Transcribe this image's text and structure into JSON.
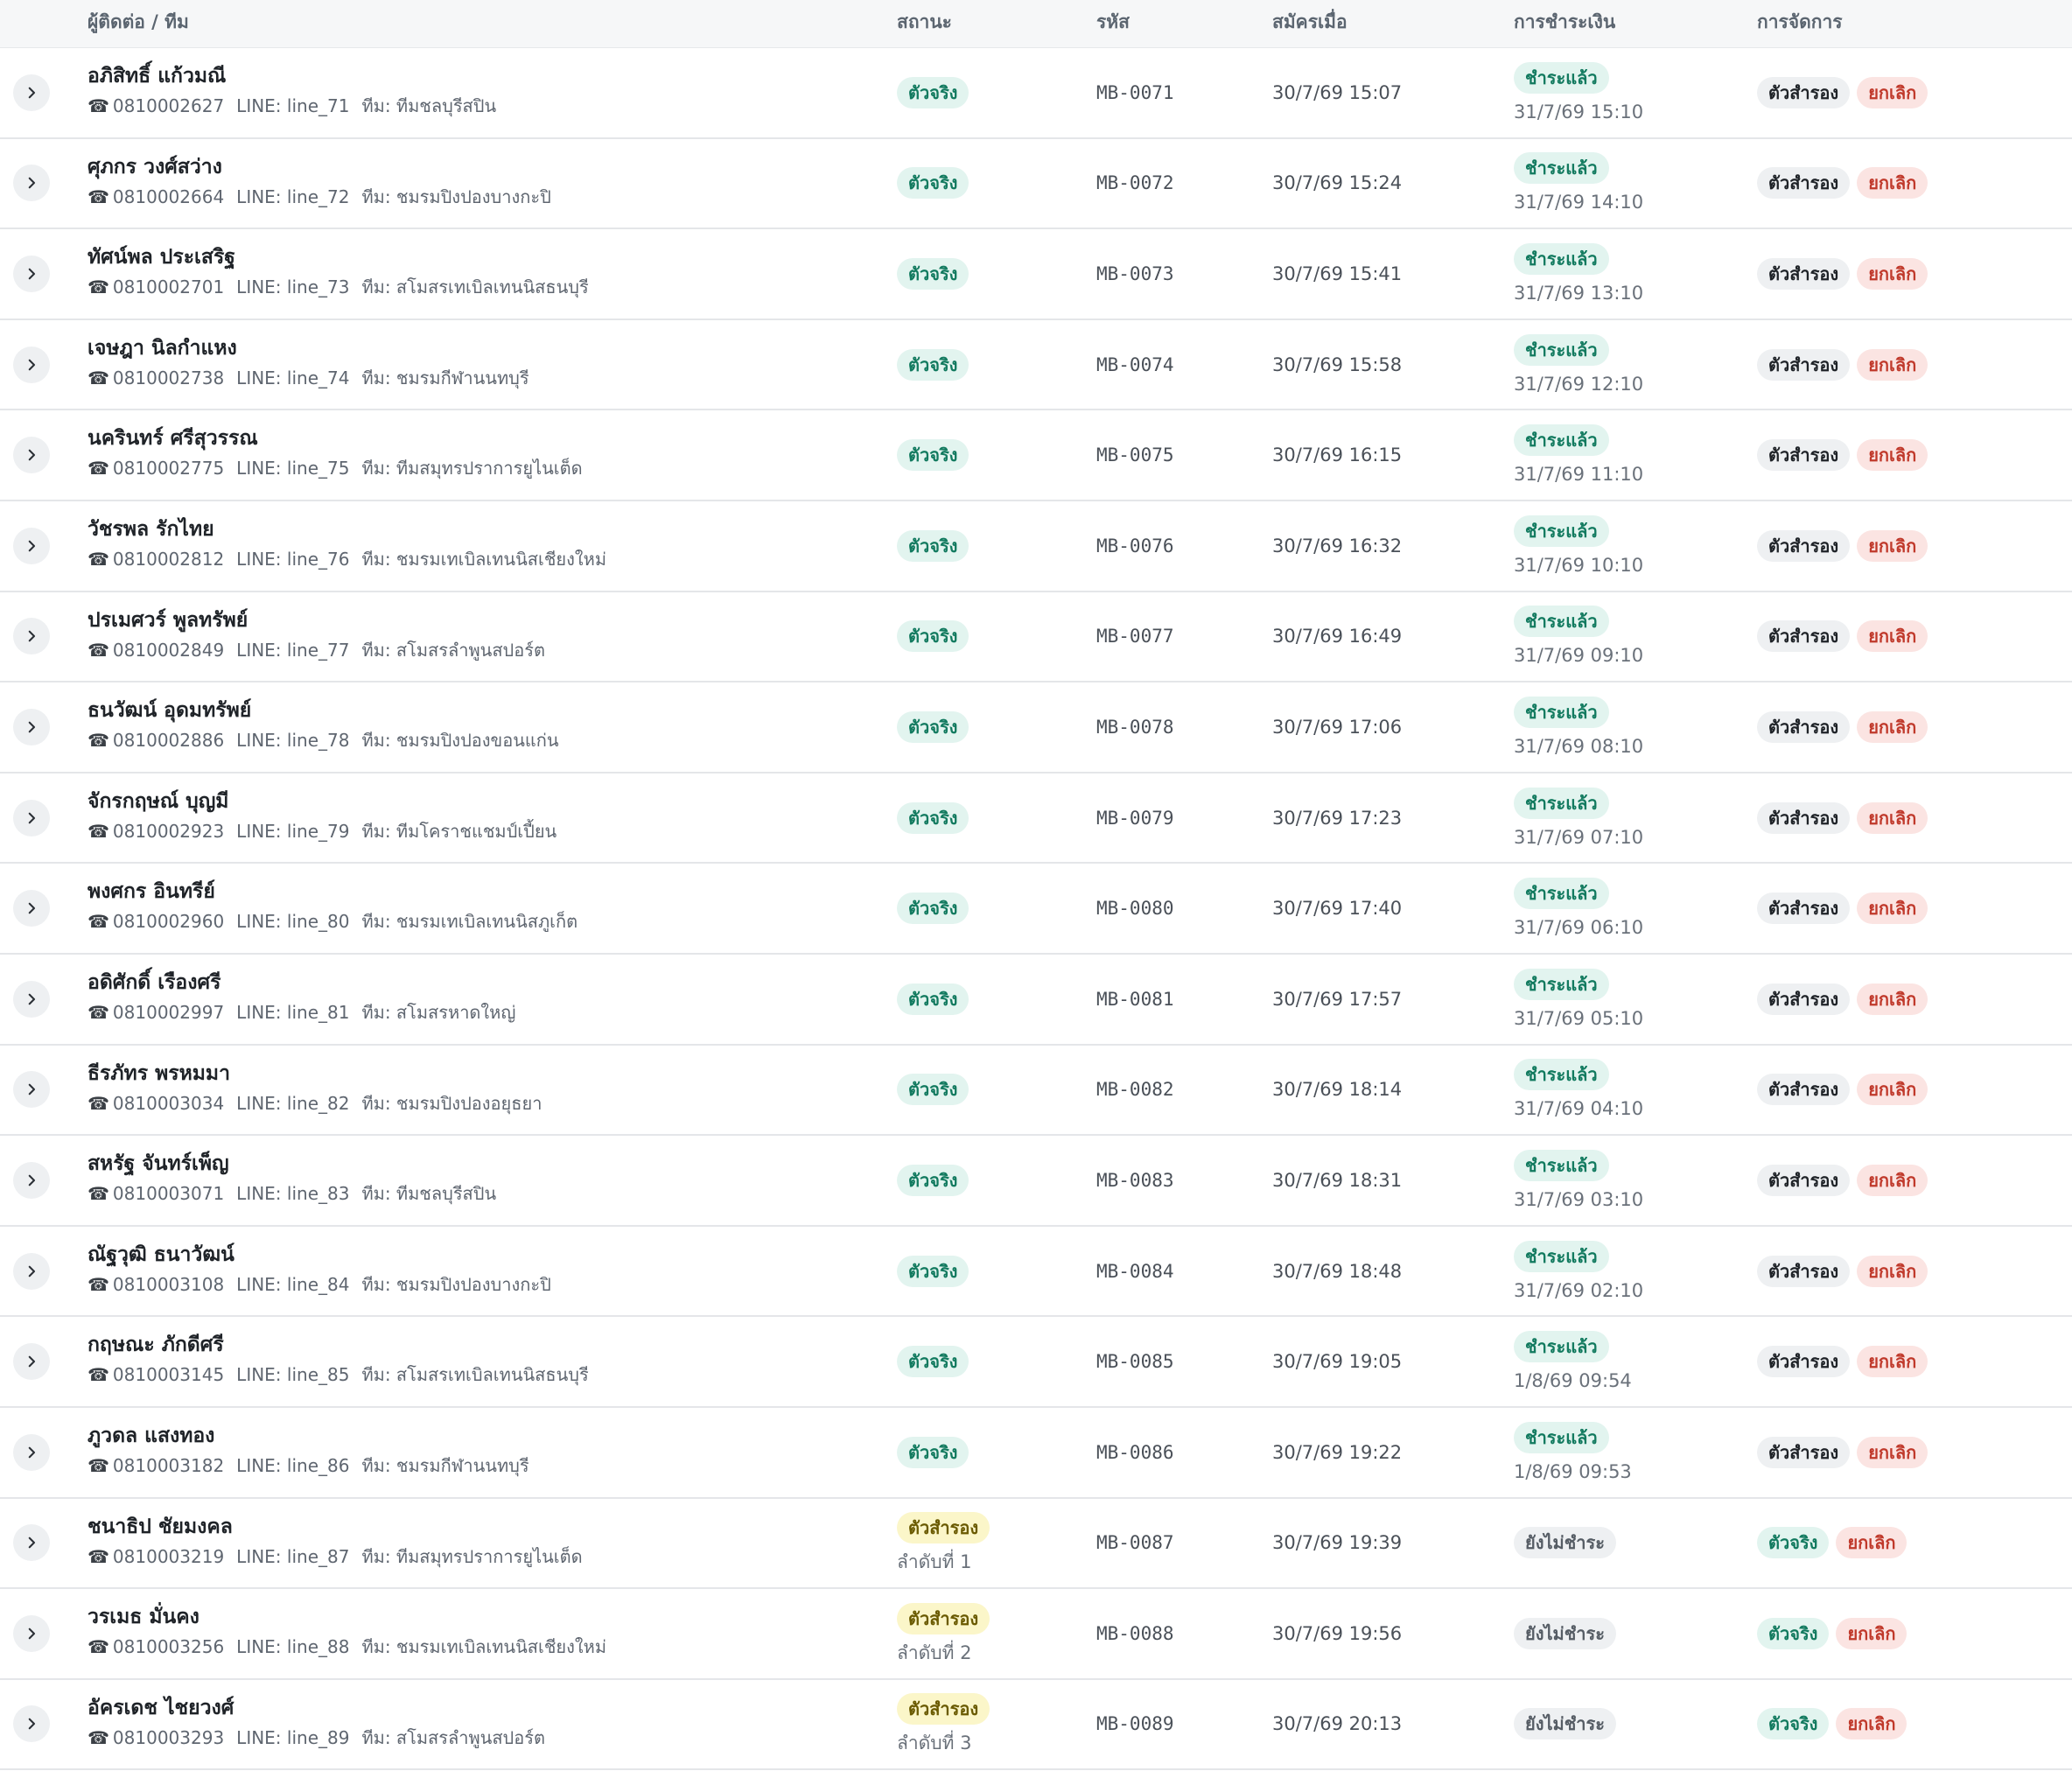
{
  "headers": {
    "contact": "ผู้ติดต่อ / ทีม",
    "status": "สถานะ",
    "code": "รหัส",
    "registered": "สมัครเมื่อ",
    "payment": "การชำระเงิน",
    "actions": "การจัดการ"
  },
  "labels": {
    "phone_icon": "☎",
    "line_prefix": "LINE: ",
    "team_prefix": "ทีม: "
  },
  "colors": {
    "main_pill_bg": "#e2f4ef",
    "main_pill_text": "#127a5f",
    "reserve_pill_bg": "#fbf6c9",
    "cancel_pill_bg": "#fbe4e2",
    "cancel_pill_text": "#c0392b"
  },
  "rows": [
    {
      "name": "อภิสิทธิ์ แก้วมณี",
      "phone": "0810002627",
      "line": "line_71",
      "team": "ทีมชลบุรีสปิน",
      "status": "ตัวจริง",
      "status_type": "main",
      "code": "MB-0071",
      "registered": "30/7/69 15:07",
      "payment": "ชำระแล้ว",
      "paid": true,
      "paid_at": "31/7/69 15:10",
      "action_primary": "ตัวสำรอง",
      "action_cancel": "ยกเลิก"
    },
    {
      "name": "ศุภกร วงศ์สว่าง",
      "phone": "0810002664",
      "line": "line_72",
      "team": "ชมรมปิงปองบางกะปิ",
      "status": "ตัวจริง",
      "status_type": "main",
      "code": "MB-0072",
      "registered": "30/7/69 15:24",
      "payment": "ชำระแล้ว",
      "paid": true,
      "paid_at": "31/7/69 14:10",
      "action_primary": "ตัวสำรอง",
      "action_cancel": "ยกเลิก"
    },
    {
      "name": "ทัศน์พล ประเสริฐ",
      "phone": "0810002701",
      "line": "line_73",
      "team": "สโมสรเทเบิลเทนนิสธนบุรี",
      "status": "ตัวจริง",
      "status_type": "main",
      "code": "MB-0073",
      "registered": "30/7/69 15:41",
      "payment": "ชำระแล้ว",
      "paid": true,
      "paid_at": "31/7/69 13:10",
      "action_primary": "ตัวสำรอง",
      "action_cancel": "ยกเลิก"
    },
    {
      "name": "เจษฎา นิลกำแหง",
      "phone": "0810002738",
      "line": "line_74",
      "team": "ชมรมกีฬานนทบุรี",
      "status": "ตัวจริง",
      "status_type": "main",
      "code": "MB-0074",
      "registered": "30/7/69 15:58",
      "payment": "ชำระแล้ว",
      "paid": true,
      "paid_at": "31/7/69 12:10",
      "action_primary": "ตัวสำรอง",
      "action_cancel": "ยกเลิก"
    },
    {
      "name": "นครินทร์ ศรีสุวรรณ",
      "phone": "0810002775",
      "line": "line_75",
      "team": "ทีมสมุทรปราการยูไนเต็ด",
      "status": "ตัวจริง",
      "status_type": "main",
      "code": "MB-0075",
      "registered": "30/7/69 16:15",
      "payment": "ชำระแล้ว",
      "paid": true,
      "paid_at": "31/7/69 11:10",
      "action_primary": "ตัวสำรอง",
      "action_cancel": "ยกเลิก"
    },
    {
      "name": "วัชรพล รักไทย",
      "phone": "0810002812",
      "line": "line_76",
      "team": "ชมรมเทเบิลเทนนิสเชียงใหม่",
      "status": "ตัวจริง",
      "status_type": "main",
      "code": "MB-0076",
      "registered": "30/7/69 16:32",
      "payment": "ชำระแล้ว",
      "paid": true,
      "paid_at": "31/7/69 10:10",
      "action_primary": "ตัวสำรอง",
      "action_cancel": "ยกเลิก"
    },
    {
      "name": "ปรเมศวร์ พูลทรัพย์",
      "phone": "0810002849",
      "line": "line_77",
      "team": "สโมสรลำพูนสปอร์ต",
      "status": "ตัวจริง",
      "status_type": "main",
      "code": "MB-0077",
      "registered": "30/7/69 16:49",
      "payment": "ชำระแล้ว",
      "paid": true,
      "paid_at": "31/7/69 09:10",
      "action_primary": "ตัวสำรอง",
      "action_cancel": "ยกเลิก"
    },
    {
      "name": "ธนวัฒน์ อุดมทรัพย์",
      "phone": "0810002886",
      "line": "line_78",
      "team": "ชมรมปิงปองขอนแก่น",
      "status": "ตัวจริง",
      "status_type": "main",
      "code": "MB-0078",
      "registered": "30/7/69 17:06",
      "payment": "ชำระแล้ว",
      "paid": true,
      "paid_at": "31/7/69 08:10",
      "action_primary": "ตัวสำรอง",
      "action_cancel": "ยกเลิก"
    },
    {
      "name": "จักรกฤษณ์ บุญมี",
      "phone": "0810002923",
      "line": "line_79",
      "team": "ทีมโคราชแชมป์เปี้ยน",
      "status": "ตัวจริง",
      "status_type": "main",
      "code": "MB-0079",
      "registered": "30/7/69 17:23",
      "payment": "ชำระแล้ว",
      "paid": true,
      "paid_at": "31/7/69 07:10",
      "action_primary": "ตัวสำรอง",
      "action_cancel": "ยกเลิก"
    },
    {
      "name": "พงศกร อินทรีย์",
      "phone": "0810002960",
      "line": "line_80",
      "team": "ชมรมเทเบิลเทนนิสภูเก็ต",
      "status": "ตัวจริง",
      "status_type": "main",
      "code": "MB-0080",
      "registered": "30/7/69 17:40",
      "payment": "ชำระแล้ว",
      "paid": true,
      "paid_at": "31/7/69 06:10",
      "action_primary": "ตัวสำรอง",
      "action_cancel": "ยกเลิก"
    },
    {
      "name": "อดิศักดิ์ เรืองศรี",
      "phone": "0810002997",
      "line": "line_81",
      "team": "สโมสรหาดใหญ่",
      "status": "ตัวจริง",
      "status_type": "main",
      "code": "MB-0081",
      "registered": "30/7/69 17:57",
      "payment": "ชำระแล้ว",
      "paid": true,
      "paid_at": "31/7/69 05:10",
      "action_primary": "ตัวสำรอง",
      "action_cancel": "ยกเลิก"
    },
    {
      "name": "ธีรภัทร พรหมมา",
      "phone": "0810003034",
      "line": "line_82",
      "team": "ชมรมปิงปองอยุธยา",
      "status": "ตัวจริง",
      "status_type": "main",
      "code": "MB-0082",
      "registered": "30/7/69 18:14",
      "payment": "ชำระแล้ว",
      "paid": true,
      "paid_at": "31/7/69 04:10",
      "action_primary": "ตัวสำรอง",
      "action_cancel": "ยกเลิก"
    },
    {
      "name": "สหรัฐ จันทร์เพ็ญ",
      "phone": "0810003071",
      "line": "line_83",
      "team": "ทีมชลบุรีสปิน",
      "status": "ตัวจริง",
      "status_type": "main",
      "code": "MB-0083",
      "registered": "30/7/69 18:31",
      "payment": "ชำระแล้ว",
      "paid": true,
      "paid_at": "31/7/69 03:10",
      "action_primary": "ตัวสำรอง",
      "action_cancel": "ยกเลิก"
    },
    {
      "name": "ณัฐวุฒิ ธนาวัฒน์",
      "phone": "0810003108",
      "line": "line_84",
      "team": "ชมรมปิงปองบางกะปิ",
      "status": "ตัวจริง",
      "status_type": "main",
      "code": "MB-0084",
      "registered": "30/7/69 18:48",
      "payment": "ชำระแล้ว",
      "paid": true,
      "paid_at": "31/7/69 02:10",
      "action_primary": "ตัวสำรอง",
      "action_cancel": "ยกเลิก"
    },
    {
      "name": "กฤษณะ ภักดีศรี",
      "phone": "0810003145",
      "line": "line_85",
      "team": "สโมสรเทเบิลเทนนิสธนบุรี",
      "status": "ตัวจริง",
      "status_type": "main",
      "code": "MB-0085",
      "registered": "30/7/69 19:05",
      "payment": "ชำระแล้ว",
      "paid": true,
      "paid_at": "1/8/69 09:54",
      "action_primary": "ตัวสำรอง",
      "action_cancel": "ยกเลิก"
    },
    {
      "name": "ภูวดล แสงทอง",
      "phone": "0810003182",
      "line": "line_86",
      "team": "ชมรมกีฬานนทบุรี",
      "status": "ตัวจริง",
      "status_type": "main",
      "code": "MB-0086",
      "registered": "30/7/69 19:22",
      "payment": "ชำระแล้ว",
      "paid": true,
      "paid_at": "1/8/69 09:53",
      "action_primary": "ตัวสำรอง",
      "action_cancel": "ยกเลิก"
    },
    {
      "name": "ชนาธิป ชัยมงคล",
      "phone": "0810003219",
      "line": "line_87",
      "team": "ทีมสมุทรปราการยูไนเต็ด",
      "status": "ตัวสำรอง",
      "status_type": "reserve",
      "status_sub": "ลำดับที่ 1",
      "code": "MB-0087",
      "registered": "30/7/69 19:39",
      "payment": "ยังไม่ชำระ",
      "paid": false,
      "action_primary": "ตัวจริง",
      "action_cancel": "ยกเลิก"
    },
    {
      "name": "วรเมธ มั่นคง",
      "phone": "0810003256",
      "line": "line_88",
      "team": "ชมรมเทเบิลเทนนิสเชียงใหม่",
      "status": "ตัวสำรอง",
      "status_type": "reserve",
      "status_sub": "ลำดับที่ 2",
      "code": "MB-0088",
      "registered": "30/7/69 19:56",
      "payment": "ยังไม่ชำระ",
      "paid": false,
      "action_primary": "ตัวจริง",
      "action_cancel": "ยกเลิก"
    },
    {
      "name": "อัครเดช ไชยวงศ์",
      "phone": "0810003293",
      "line": "line_89",
      "team": "สโมสรลำพูนสปอร์ต",
      "status": "ตัวสำรอง",
      "status_type": "reserve",
      "status_sub": "ลำดับที่ 3",
      "code": "MB-0089",
      "registered": "30/7/69 20:13",
      "payment": "ยังไม่ชำระ",
      "paid": false,
      "action_primary": "ตัวจริง",
      "action_cancel": "ยกเลิก"
    }
  ]
}
